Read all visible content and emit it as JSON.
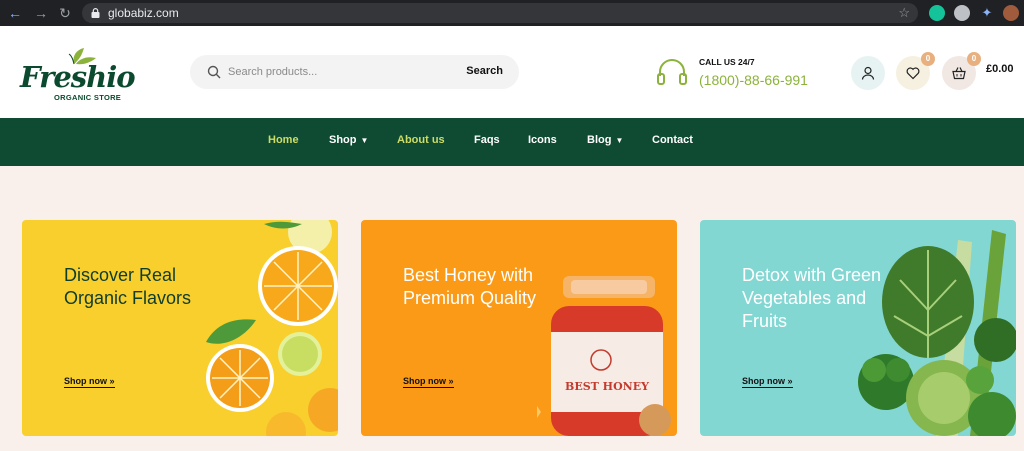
{
  "browser": {
    "url": "globabiz.com",
    "icons": [
      "back-arrow-icon",
      "forward-arrow-icon",
      "reload-icon",
      "lock-icon",
      "star-icon",
      "grammarly-icon",
      "extension-icon",
      "puzzle-icon",
      "avatar"
    ]
  },
  "header": {
    "logo_word": "Freshio",
    "logo_sub": "ORGANIC STORE",
    "search": {
      "placeholder": "Search products...",
      "button": "Search"
    },
    "call": {
      "label": "CALL US 24/7",
      "number": "(1800)-88-66-991"
    },
    "wishlist_count": "0",
    "cart_count": "0",
    "cart_total": "£0.00"
  },
  "nav": {
    "items": [
      {
        "label": "Home",
        "active": true
      },
      {
        "label": "Shop",
        "dropdown": true
      },
      {
        "label": "About us",
        "active": true
      },
      {
        "label": "Faqs"
      },
      {
        "label": "Icons"
      },
      {
        "label": "Blog",
        "dropdown": true
      },
      {
        "label": "Contact"
      }
    ]
  },
  "banners": [
    {
      "title": "Discover Real Organic Flavors",
      "link": "Shop now »",
      "color": "#f8cf2d"
    },
    {
      "title": "Best Honey with Premium Quality",
      "link": "Shop now »",
      "color": "#fb9a16",
      "jar_label": "BEST HONEY"
    },
    {
      "title": "Detox with Green Vegetables and Fruits",
      "link": "Shop now »",
      "color": "#82d7d3"
    }
  ],
  "colors": {
    "primary_green": "#0e4b32",
    "accent_lime": "#cddc65",
    "accent_green": "#8bb33b",
    "page_bg": "#f9f0eb"
  }
}
